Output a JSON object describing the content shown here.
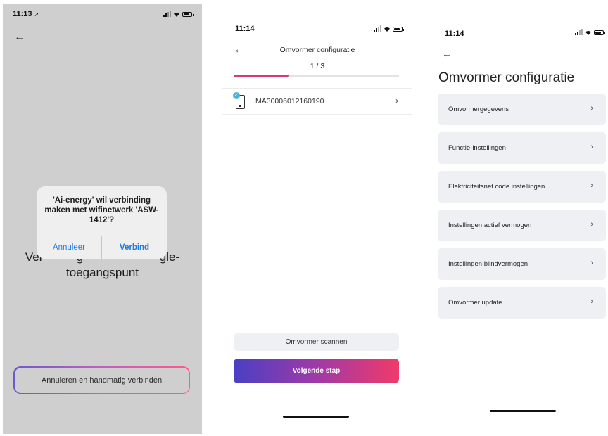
{
  "screen1": {
    "time": "11:13",
    "location_arrow": "➚",
    "back_icon": "←",
    "background_text_line1": "Ver          g                       gle-",
    "background_text_line2": "toegangspunt",
    "dialog": {
      "message": "'Ai-energy' wil verbinding maken met wifinetwerk 'ASW-1412'?",
      "cancel_label": "Annuleer",
      "confirm_label": "Verbind"
    },
    "manual_connect_label": "Annuleren en handmatig verbinden"
  },
  "screen2": {
    "time": "11:14",
    "back_icon": "←",
    "title": "Omvormer configuratie",
    "step": "1 / 3",
    "progress_fraction": 0.333,
    "device": {
      "serial": "MA30006012160190",
      "check_icon": "✓",
      "chevron": "›"
    },
    "scan_label": "Omvormer scannen",
    "next_label": "Volgende stap"
  },
  "screen3": {
    "time": "11:14",
    "back_icon": "←",
    "title": "Omvormer configuratie",
    "chevron": "›",
    "menu": [
      {
        "label": "Omvormergegevens"
      },
      {
        "label": "Functie-instellingen"
      },
      {
        "label": "Elektriciteitsnet code instellingen"
      },
      {
        "label": "Instellingen actief vermogen"
      },
      {
        "label": "Instellingen blindvermogen"
      },
      {
        "label": "Omvormer update"
      }
    ]
  },
  "colors": {
    "accent_blue": "#1e7ae6",
    "progress_pink": "#d43a76",
    "gradient_start": "#4a3fc4",
    "gradient_end": "#f03a6a",
    "check_blue": "#4bb3d6"
  }
}
